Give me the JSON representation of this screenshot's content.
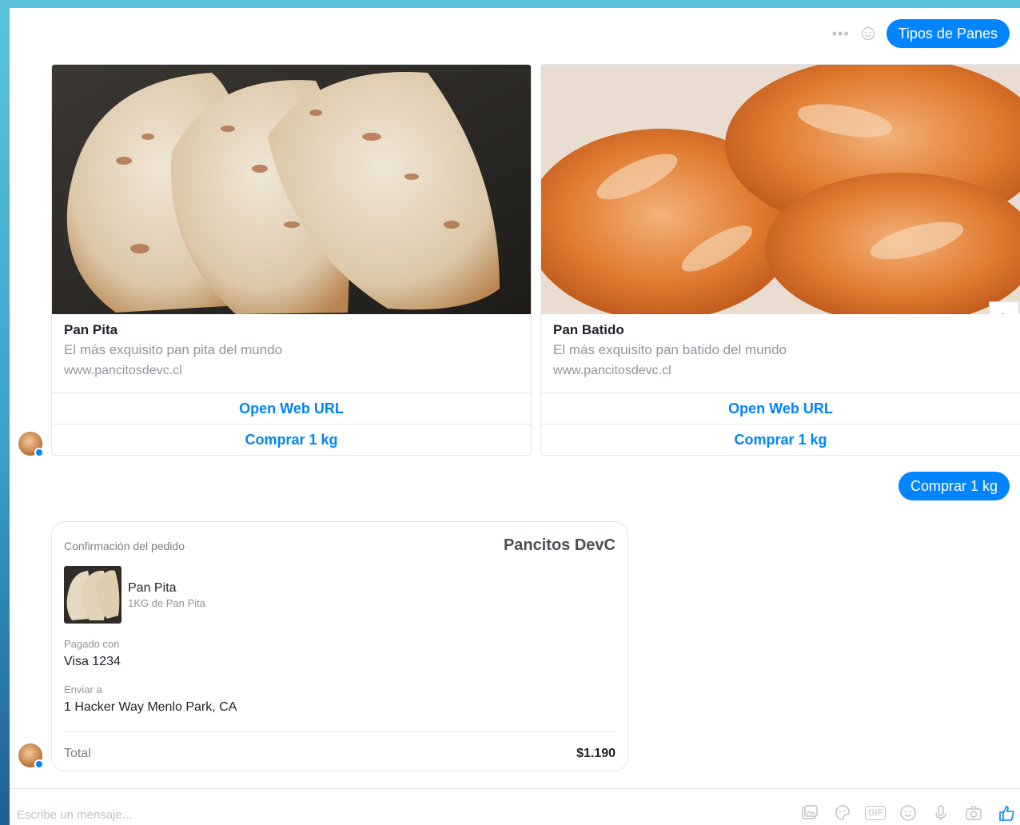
{
  "header": {
    "more_icon": "more-dots-icon",
    "emoji_icon": "smile-icon",
    "user_message": "Tipos de Panes"
  },
  "carousel": {
    "cards": [
      {
        "title": "Pan Pita",
        "subtitle": "El más exquisito pan pita del mundo",
        "url": "www.pancitosdevc.cl",
        "button_1": "Open Web URL",
        "button_2": "Comprar 1 kg"
      },
      {
        "title": "Pan Batido",
        "subtitle": "El más exquisito pan batido del mundo",
        "url": "www.pancitosdevc.cl",
        "button_1": "Open Web URL",
        "button_2": "Comprar 1 kg"
      }
    ],
    "next_icon": "chevron-right-icon"
  },
  "reply": "Comprar 1 kg",
  "receipt": {
    "label": "Confirmación del pedido",
    "merchant": "Pancitos DevC",
    "item_name": "Pan Pita",
    "item_desc": "1KG de Pan Pita",
    "paid_label": "Pagado con",
    "paid_value": "Visa 1234",
    "ship_label": "Enviar a",
    "ship_value": "1 Hacker Way Menlo Park, CA",
    "total_label": "Total",
    "total_value": "$1.190"
  },
  "composer": {
    "placeholder": "Escribe un mensaje...",
    "tools": [
      "image-icon",
      "sticker-icon",
      "gif-icon",
      "emoji-icon",
      "microphone-icon",
      "camera-icon",
      "like-icon"
    ],
    "gif_label": "GIF"
  },
  "colors": {
    "accent": "#0084ff",
    "muted": "#90949c"
  }
}
